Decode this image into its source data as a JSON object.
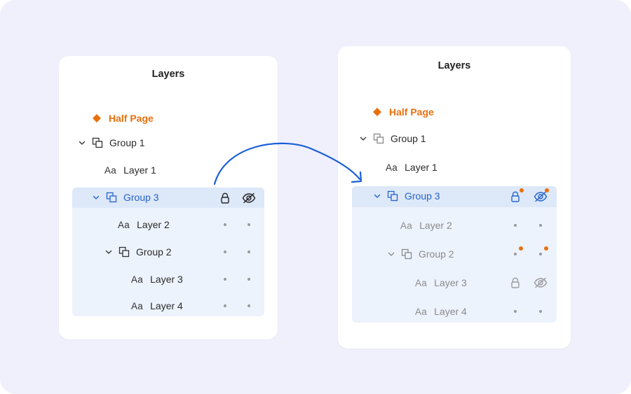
{
  "colors": {
    "background": "#f0f0fd",
    "panel": "#ffffff",
    "accent_orange": "#e8700c",
    "accent_blue": "#2563c9",
    "selection_bg": "#edf3fd",
    "selection_head": "#dde8f9",
    "arrow": "#1a5fd6"
  },
  "before": {
    "title": "Layers",
    "rows": {
      "half_page": "Half Page",
      "group1": "Group 1",
      "layer1": "Layer 1",
      "group3": "Group 3",
      "layer2": "Layer 2",
      "group2": "Group 2",
      "layer3": "Layer 3",
      "layer4": "Layer 4"
    },
    "text_glyph": "Aa"
  },
  "after": {
    "title": "Layers",
    "rows": {
      "half_page": "Half Page",
      "group1": "Group 1",
      "layer1": "Layer 1",
      "group3": "Group 3",
      "layer2": "Layer 2",
      "group2": "Group 2",
      "layer3": "Layer 3",
      "layer4": "Layer 4"
    },
    "text_glyph": "Aa"
  },
  "icons": {
    "half_page": "diamond-icon",
    "group": "group-icon",
    "expand": "chevron-down-icon",
    "lock": "lock-icon",
    "visibility": "eye-off-icon",
    "mixed_state": "orange-dot-badge"
  }
}
